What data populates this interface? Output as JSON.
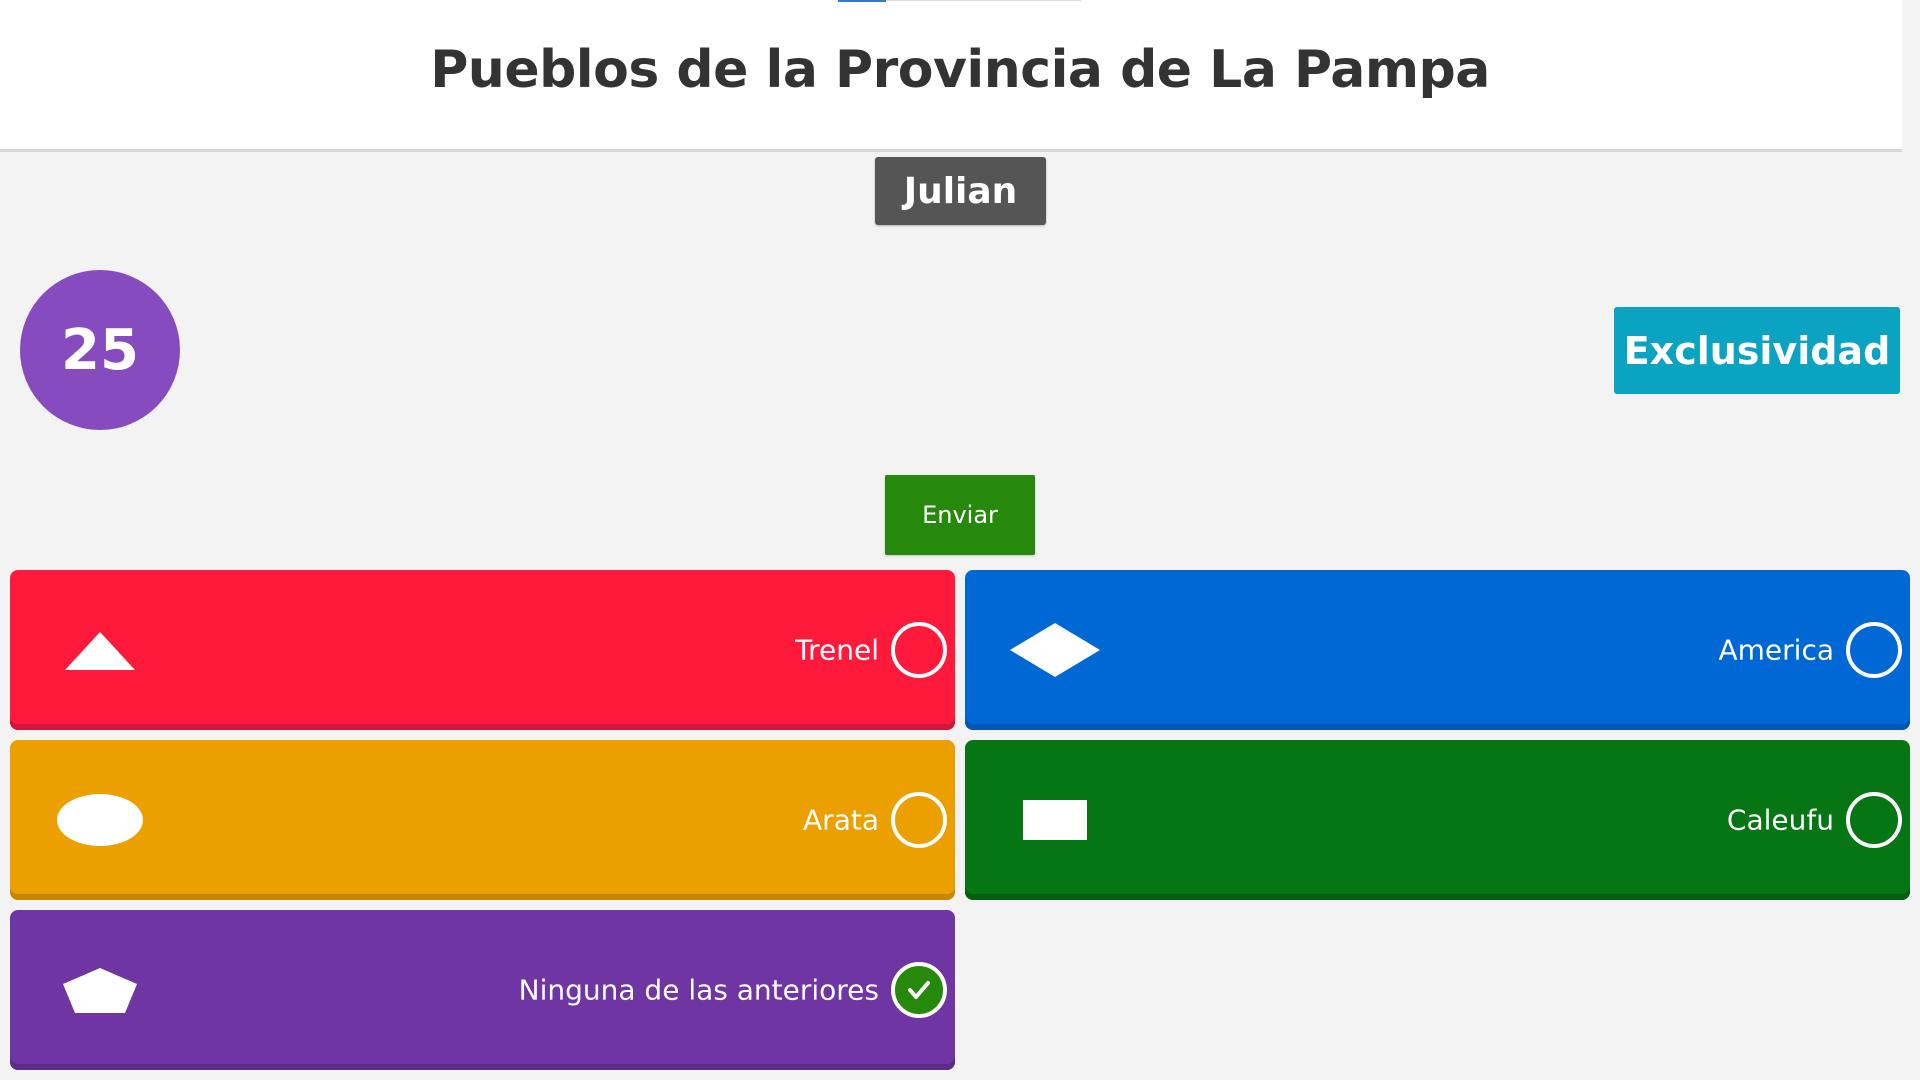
{
  "header": {
    "title": "Pueblos de la Provincia de La Pampa"
  },
  "player": {
    "name": "Julian"
  },
  "timer": {
    "value": "25"
  },
  "mode": {
    "label": "Exclusividad"
  },
  "actions": {
    "submit_label": "Enviar"
  },
  "answers": [
    {
      "label": "Trenel",
      "shape": "triangle-icon",
      "color": "#ff1a3c",
      "selected": false
    },
    {
      "label": "America",
      "shape": "diamond-icon",
      "color": "#0068d4",
      "selected": false
    },
    {
      "label": "Arata",
      "shape": "ellipse-icon",
      "color": "#eba000",
      "selected": false
    },
    {
      "label": "Caleufu",
      "shape": "rectangle-icon",
      "color": "#067614",
      "selected": false
    },
    {
      "label": "Ninguna de las anteriores",
      "shape": "pentagon-icon",
      "color": "#6e35a3",
      "selected": true
    }
  ],
  "colors": {
    "timer": "#864cbf",
    "mode_badge": "#0aa3c2",
    "submit": "#26890c",
    "player_badge": "#555555"
  }
}
